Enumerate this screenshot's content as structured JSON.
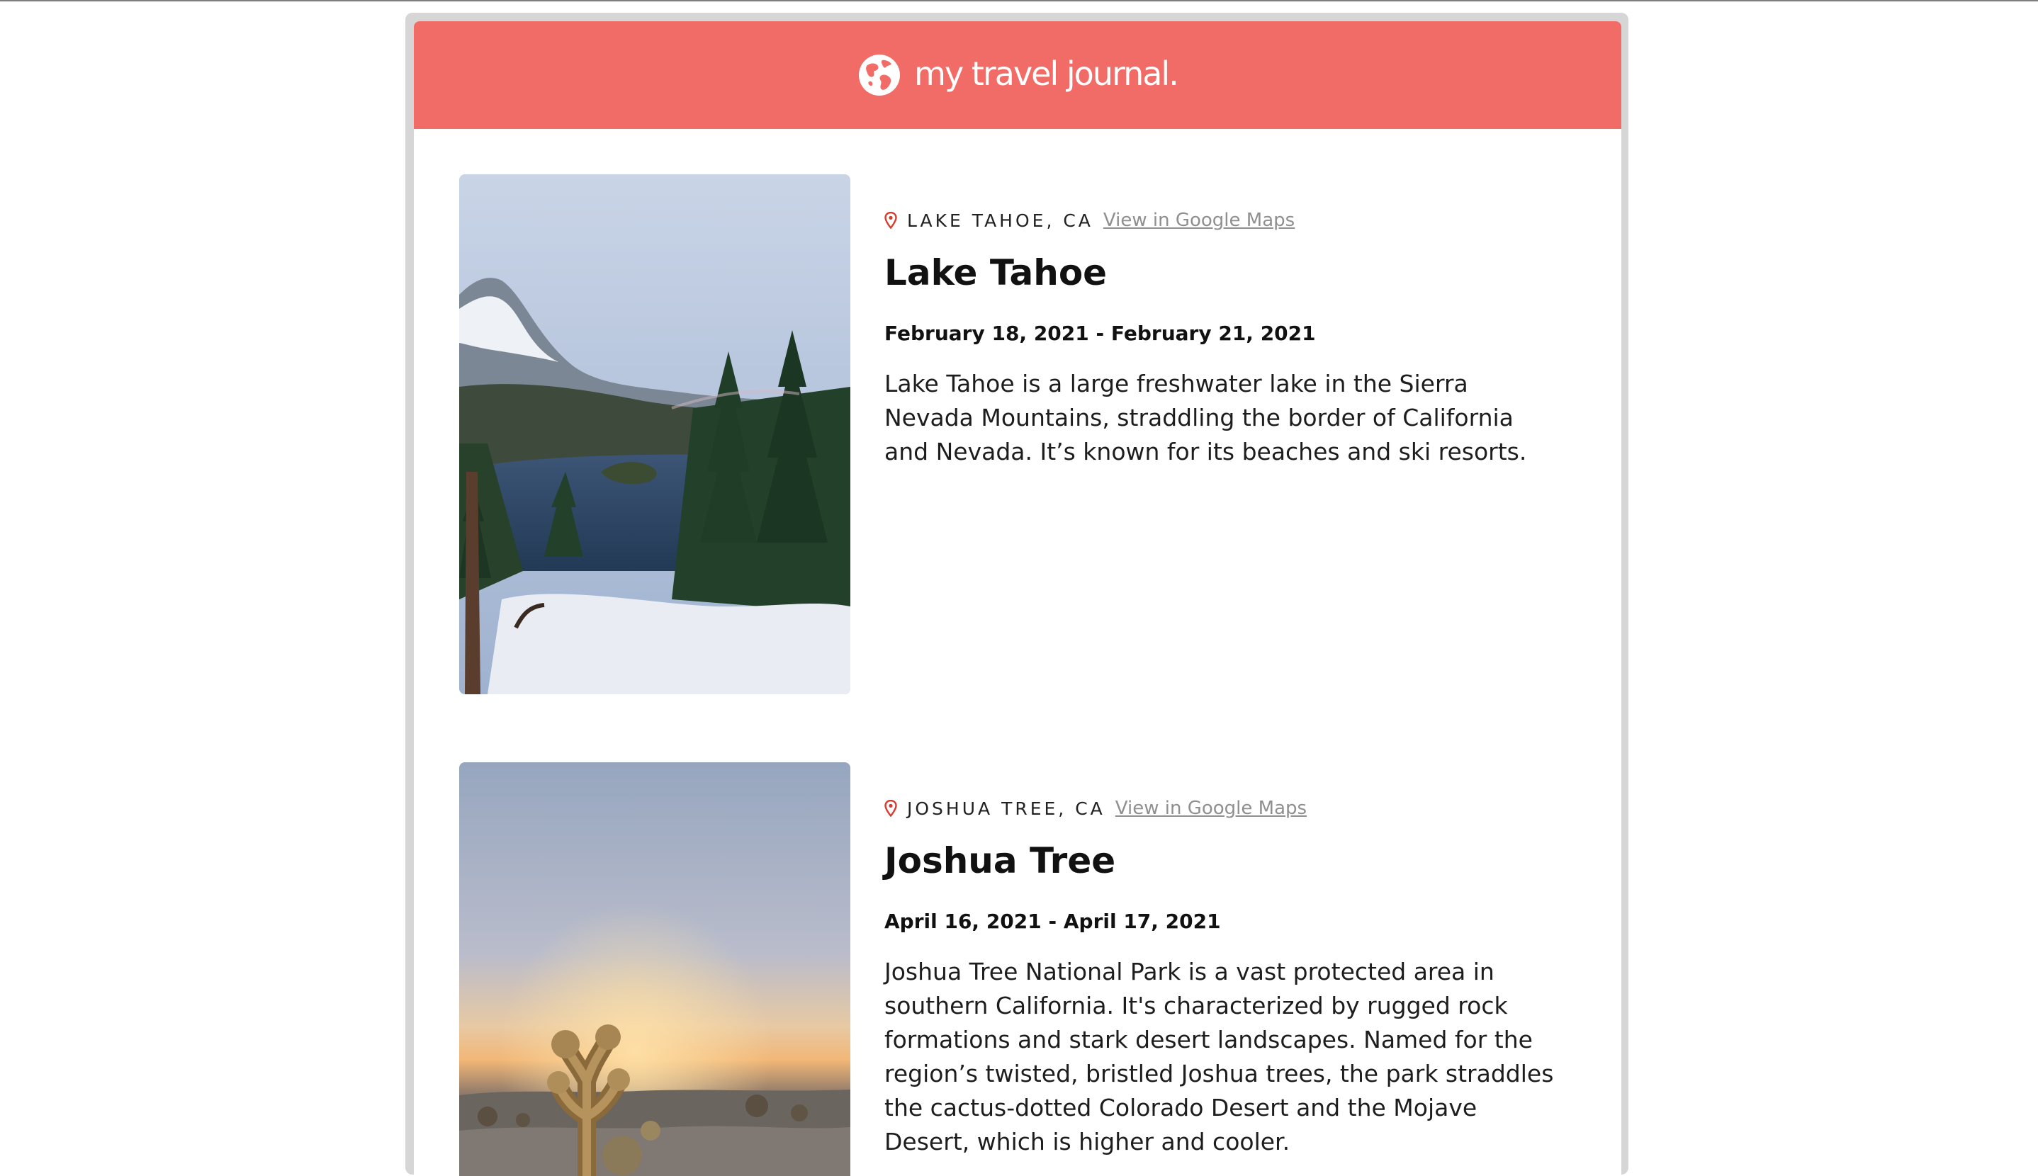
{
  "header": {
    "brand": "my travel journal.",
    "color": "#f16c67"
  },
  "entries": [
    {
      "location": "LAKE TAHOE, CA",
      "maps_link": "View in Google Maps",
      "title": "Lake Tahoe",
      "dates": "February 18, 2021 - February 21, 2021",
      "description": "Lake Tahoe is a large freshwater lake in the Sierra Nevada Mountains, straddling the border of California and Nevada. It’s known for its beaches and ski resorts."
    },
    {
      "location": "JOSHUA TREE, CA",
      "maps_link": "View in Google Maps",
      "title": "Joshua Tree",
      "dates": "April 16, 2021 - April 17, 2021",
      "description": "Joshua Tree National Park is a vast protected area in southern California. It's characterized by rugged rock formations and stark desert landscapes. Named for the region’s twisted, bristled Joshua trees, the park straddles the cactus-dotted Colorado Desert and the Mojave Desert, which is higher and cooler."
    }
  ],
  "icons": {
    "brand": "globe-icon",
    "location": "location-pin-icon"
  },
  "pin_color": "#d93a2b"
}
